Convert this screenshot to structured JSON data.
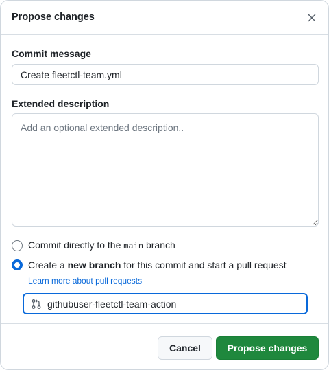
{
  "dialog": {
    "title": "Propose changes",
    "close_icon": "x-icon"
  },
  "commit_message": {
    "label": "Commit message",
    "value": "Create fleetctl-team.yml"
  },
  "extended_description": {
    "label": "Extended description",
    "placeholder": "Add an optional extended description.."
  },
  "branch_options": {
    "direct": {
      "prefix": "Commit directly to the ",
      "branch_name": "main",
      "suffix": " branch",
      "checked": false
    },
    "new_branch": {
      "prefix": "Create a ",
      "bold": "new branch",
      "suffix": " for this commit and start a pull request",
      "checked": true
    },
    "learn_more": "Learn more about pull requests",
    "branch_icon": "git-pull-request-icon",
    "new_branch_name": "githubuser-fleetctl-team-action"
  },
  "footer": {
    "cancel_label": "Cancel",
    "submit_label": "Propose changes"
  },
  "colors": {
    "accent": "#0969da",
    "primary_button": "#1f883d"
  }
}
